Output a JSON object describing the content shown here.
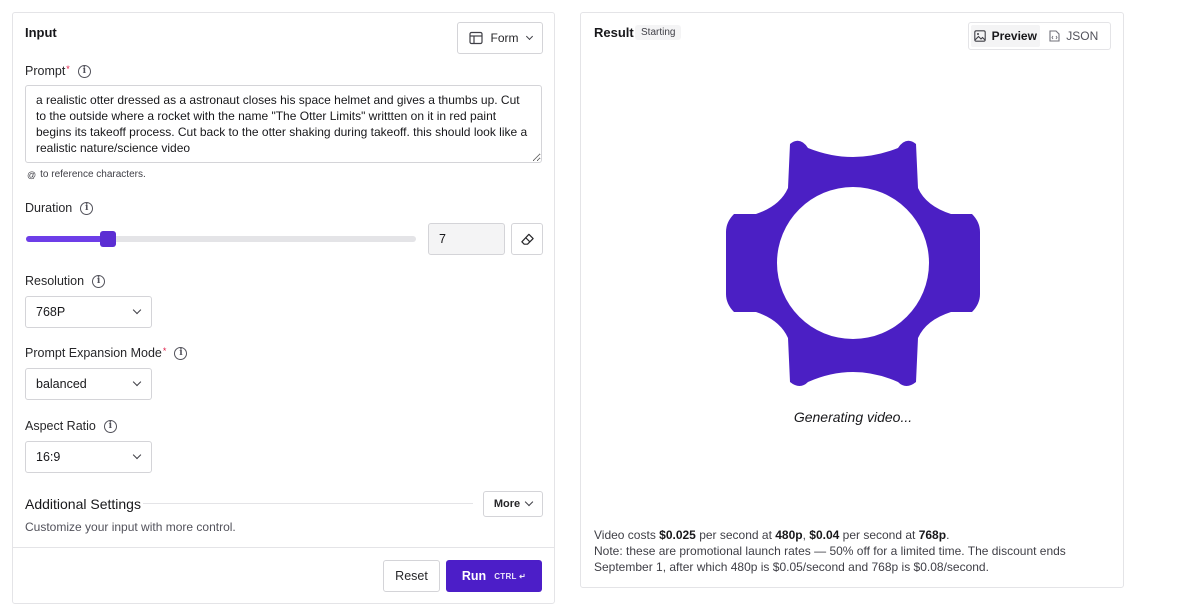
{
  "input": {
    "title": "Input",
    "mode_select": {
      "value": "Form",
      "icon": "table-layout-icon"
    },
    "prompt": {
      "label": "Prompt",
      "required_mark": "*",
      "value": "a realistic otter dressed as a astronaut closes his space helmet and gives a thumbs up. Cut to the outside where a rocket with the name \"The Otter Limits\" writtten on it in red paint begins its takeoff process. Cut back to the otter shaking during takeoff. this should look like a realistic nature/science video",
      "hint_symbol": "@",
      "hint": "to reference characters."
    },
    "duration": {
      "label": "Duration",
      "value": "7",
      "slider_fraction": 0.21,
      "clear_icon": "eraser-icon"
    },
    "resolution": {
      "label": "Resolution",
      "value": "768P"
    },
    "prompt_expansion": {
      "label": "Prompt Expansion Mode",
      "required_mark": "*",
      "value": "balanced"
    },
    "aspect_ratio": {
      "label": "Aspect Ratio",
      "value": "16:9"
    },
    "additional": {
      "title": "Additional Settings",
      "subtitle": "Customize your input with more control.",
      "more_label": "More"
    },
    "reset_label": "Reset",
    "run_label": "Run",
    "run_shortcut": "CTRL ↵"
  },
  "result": {
    "title": "Result",
    "status": "Starting",
    "tabs": [
      {
        "label": "Preview",
        "icon": "image-icon",
        "active": true
      },
      {
        "label": "JSON",
        "icon": "file-code-icon",
        "active": false
      }
    ],
    "loader_color": "#4b1fc4",
    "generating_text": "Generating video...",
    "note": {
      "line1_pre": "Video costs ",
      "price_480": "$0.025",
      "line1_mid": " per second at ",
      "res_480": "480p",
      "sep": ", ",
      "price_768": "$0.04",
      "line1_mid2": " per second at ",
      "res_768": "768p",
      "line1_end": ".",
      "line2": "Note: these are promotional launch rates — 50% off for a limited time. The discount ends September 1, after which 480p is $0.05/second and 768p is $0.08/second."
    }
  },
  "accent_color": "#4c1ec8"
}
